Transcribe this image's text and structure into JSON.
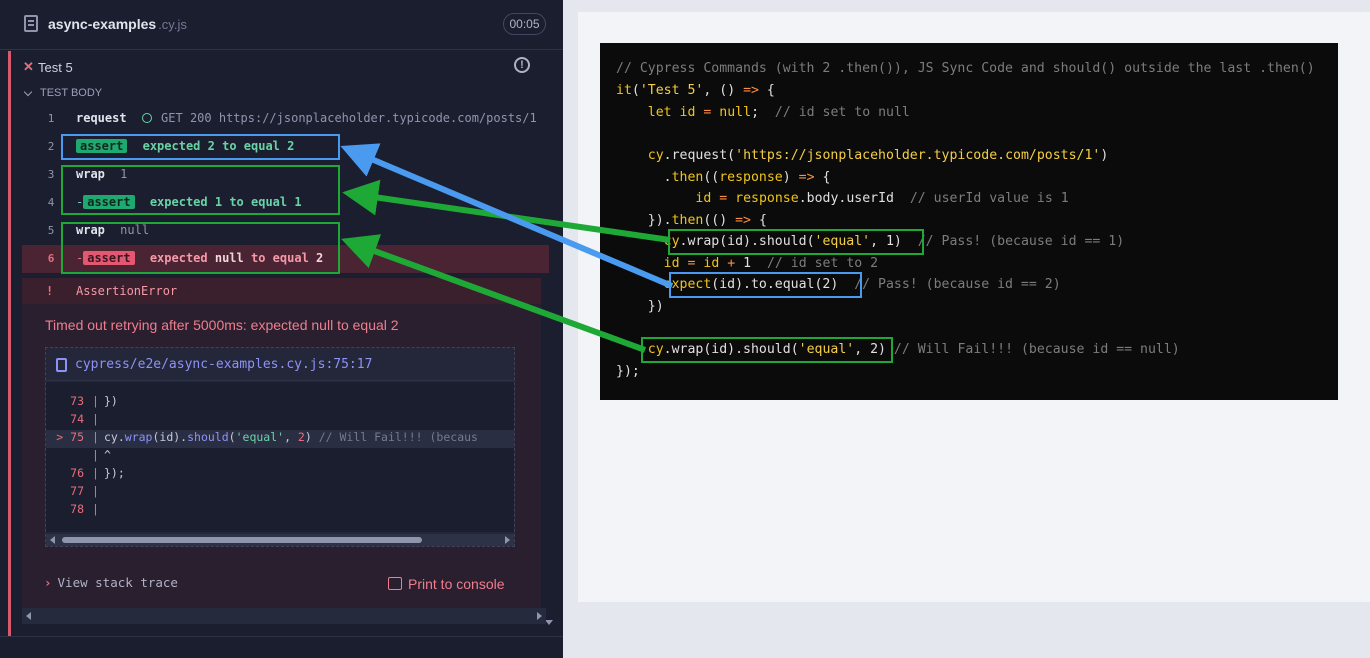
{
  "reporter": {
    "file_name": "async-examples",
    "file_ext": ".cy.js",
    "timer": "00:05",
    "test_title": "Test 5",
    "body_label": "TEST BODY",
    "commands": [
      {
        "num": "1",
        "name": "request",
        "detail": "GET 200 https://jsonplaceholder.typicode.com/posts/1"
      },
      {
        "num": "2",
        "badge": "assert",
        "expected": "expected",
        "actual": "2",
        "to_equal": "to equal",
        "target": "2"
      },
      {
        "num": "3",
        "name": "wrap",
        "detail": "1"
      },
      {
        "num": "4",
        "dash": "-",
        "badge": "assert",
        "expected": "expected",
        "actual": "1",
        "to_equal": "to equal",
        "target": "1"
      },
      {
        "num": "5",
        "name": "wrap",
        "detail": "null"
      },
      {
        "num": "6",
        "dash": "-",
        "badge": "assert",
        "expected": "expected",
        "actual": "null",
        "to_equal": "to equal",
        "target": "2"
      }
    ],
    "error": {
      "bang": "!",
      "title": "AssertionError",
      "message": "Timed out retrying after 5000ms: expected null to equal 2",
      "file_path": "cypress/e2e/async-examples.cy.js:75:17",
      "lines": [
        {
          "num": "73",
          "code": "   })"
        },
        {
          "num": "74",
          "code": ""
        },
        {
          "num": "75",
          "marker": ">",
          "pre": "   cy.",
          "fn1": "wrap",
          "mid1": "(id).",
          "fn2": "should",
          "open": "(",
          "str": "'equal'",
          "sep": ", ",
          "arg": "2",
          "close": ")",
          "comment": " // Will Fail!!! (becaus"
        },
        {
          "num": "",
          "code": "              ^"
        },
        {
          "num": "76",
          "code": "});"
        },
        {
          "num": "77",
          "code": ""
        },
        {
          "num": "78",
          "code": ""
        }
      ],
      "stack_link": "View stack trace",
      "print_button": "Print to console"
    }
  },
  "code_block": {
    "lines": [
      {
        "tokens": [
          {
            "t": "com",
            "v": "// Cypress Commands (with 2 .then()), JS Sync Code and should() outside the last .then()"
          }
        ]
      },
      {
        "tokens": [
          {
            "t": "kw",
            "v": "it"
          },
          {
            "t": "plain",
            "v": "("
          },
          {
            "t": "str",
            "v": "'Test 5'"
          },
          {
            "t": "plain",
            "v": ", () "
          },
          {
            "t": "op",
            "v": "=>"
          },
          {
            "t": "plain",
            "v": " {"
          }
        ]
      },
      {
        "tokens": [
          {
            "t": "plain",
            "v": "    "
          },
          {
            "t": "kw",
            "v": "let"
          },
          {
            "t": "plain",
            "v": " "
          },
          {
            "t": "var",
            "v": "id"
          },
          {
            "t": "plain",
            "v": " "
          },
          {
            "t": "op",
            "v": "="
          },
          {
            "t": "plain",
            "v": " "
          },
          {
            "t": "kw",
            "v": "null"
          },
          {
            "t": "plain",
            "v": ";  "
          },
          {
            "t": "com",
            "v": "// id set to null"
          }
        ]
      },
      {
        "tokens": [
          {
            "t": "plain",
            "v": ""
          }
        ]
      },
      {
        "tokens": [
          {
            "t": "plain",
            "v": "    "
          },
          {
            "t": "kw",
            "v": "cy"
          },
          {
            "t": "plain",
            "v": ".request("
          },
          {
            "t": "str",
            "v": "'https://jsonplaceholder.typicode.com/posts/1'"
          },
          {
            "t": "plain",
            "v": ")"
          }
        ]
      },
      {
        "tokens": [
          {
            "t": "plain",
            "v": "      ."
          },
          {
            "t": "kw",
            "v": "then"
          },
          {
            "t": "plain",
            "v": "(("
          },
          {
            "t": "var",
            "v": "response"
          },
          {
            "t": "plain",
            "v": ") "
          },
          {
            "t": "op",
            "v": "=>"
          },
          {
            "t": "plain",
            "v": " {"
          }
        ]
      },
      {
        "tokens": [
          {
            "t": "plain",
            "v": "          "
          },
          {
            "t": "var",
            "v": "id"
          },
          {
            "t": "plain",
            "v": " "
          },
          {
            "t": "op",
            "v": "="
          },
          {
            "t": "plain",
            "v": " "
          },
          {
            "t": "var",
            "v": "response"
          },
          {
            "t": "plain",
            "v": ".body.userId  "
          },
          {
            "t": "com",
            "v": "// userId value is 1"
          }
        ]
      },
      {
        "tokens": [
          {
            "t": "plain",
            "v": "    })."
          },
          {
            "t": "kw",
            "v": "then"
          },
          {
            "t": "plain",
            "v": "(() "
          },
          {
            "t": "op",
            "v": "=>"
          },
          {
            "t": "plain",
            "v": " {"
          }
        ]
      },
      {
        "tokens": [
          {
            "t": "plain",
            "v": "      "
          },
          {
            "t": "kw",
            "v": "cy"
          },
          {
            "t": "plain",
            "v": ".wrap(id).should("
          },
          {
            "t": "str",
            "v": "'equal'"
          },
          {
            "t": "plain",
            "v": ", 1)  "
          },
          {
            "t": "com",
            "v": "// Pass! (because id == 1)"
          }
        ]
      },
      {
        "tokens": [
          {
            "t": "plain",
            "v": "      "
          },
          {
            "t": "var",
            "v": "id"
          },
          {
            "t": "plain",
            "v": " "
          },
          {
            "t": "op",
            "v": "="
          },
          {
            "t": "plain",
            "v": " "
          },
          {
            "t": "var",
            "v": "id"
          },
          {
            "t": "plain",
            "v": " "
          },
          {
            "t": "op",
            "v": "+"
          },
          {
            "t": "plain",
            "v": " 1  "
          },
          {
            "t": "com",
            "v": "// id set to 2"
          }
        ]
      },
      {
        "tokens": [
          {
            "t": "plain",
            "v": "      "
          },
          {
            "t": "kw",
            "v": "expect"
          },
          {
            "t": "plain",
            "v": "(id).to.equal(2)  "
          },
          {
            "t": "com",
            "v": "// Pass! (because id == 2)"
          }
        ]
      },
      {
        "tokens": [
          {
            "t": "plain",
            "v": "    })"
          }
        ]
      },
      {
        "tokens": [
          {
            "t": "plain",
            "v": ""
          }
        ]
      },
      {
        "tokens": [
          {
            "t": "plain",
            "v": "    "
          },
          {
            "t": "kw",
            "v": "cy"
          },
          {
            "t": "plain",
            "v": ".wrap(id).should("
          },
          {
            "t": "str",
            "v": "'equal'"
          },
          {
            "t": "plain",
            "v": ", 2) "
          },
          {
            "t": "com",
            "v": "// Will Fail!!! (because id == null)"
          }
        ]
      },
      {
        "tokens": [
          {
            "t": "plain",
            "v": "});"
          }
        ]
      }
    ]
  },
  "colors": {
    "pass_badge": "#1fa971",
    "fail_badge": "#e45770",
    "fail_accent": "#d65a69",
    "green_arrow": "#1ea936",
    "blue_arrow": "#4a9af0"
  }
}
